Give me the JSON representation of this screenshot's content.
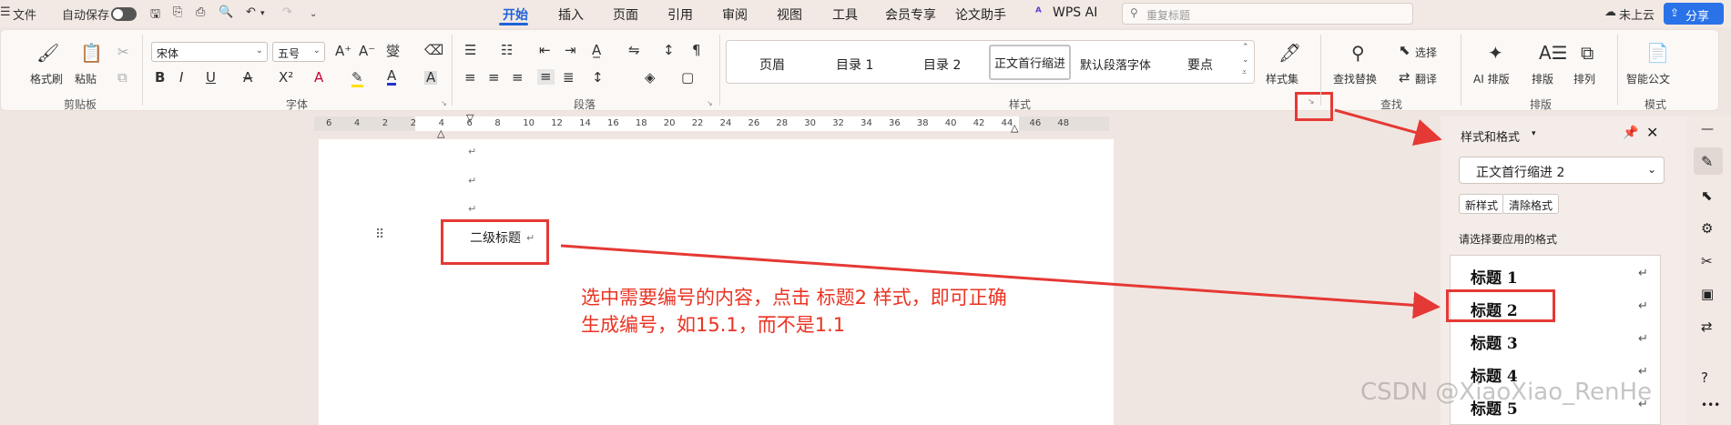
{
  "titlebar": {
    "menu_label": "文件",
    "autosave_label": "自动保存",
    "tabs": [
      "开始",
      "插入",
      "页面",
      "引用",
      "审阅",
      "视图",
      "工具",
      "会员专享",
      "论文助手",
      "WPS AI"
    ],
    "search_placeholder": "重复标题",
    "cloud_label": "未上云",
    "share_label": "分享"
  },
  "ribbon": {
    "clipboard": {
      "group": "剪贴板",
      "format_painter": "格式刷",
      "paste": "粘贴"
    },
    "font": {
      "group": "字体",
      "font_name": "宋体",
      "font_size": "五号"
    },
    "paragraph": {
      "group": "段落"
    },
    "styles": {
      "group": "样式",
      "gallery": [
        "页眉",
        "目录 1",
        "目录 2",
        "正文首行缩进",
        "默认段落字体",
        "要点"
      ],
      "style_set": "样式集"
    },
    "find": {
      "group": "查找",
      "find_replace": "查找替换",
      "select": "选择",
      "translate": "翻译"
    },
    "arrange": {
      "group": "排版",
      "ai_layout": "AI 排版",
      "layout": "排版",
      "arrange": "排列"
    },
    "template": {
      "group": "模式",
      "smart_doc": "智能公文"
    }
  },
  "ruler": {
    "numbers": [
      "6",
      "4",
      "2",
      "2",
      "4",
      "6",
      "8",
      "10",
      "12",
      "14",
      "16",
      "18",
      "20",
      "22",
      "24",
      "26",
      "28",
      "30",
      "32",
      "34",
      "36",
      "38",
      "40",
      "42",
      "44",
      "46",
      "48"
    ]
  },
  "document": {
    "heading_text": "二级标题",
    "annotation_line1": "选中需要编号的内容，点击 标题2 样式，即可正确",
    "annotation_line2": "生成编号，如15.1，而不是1.1"
  },
  "styles_panel": {
    "title": "样式和格式",
    "current_style": "正文首行缩进 2",
    "new_style": "新样式",
    "clear_format": "清除格式",
    "apply_label": "请选择要应用的格式",
    "headings": [
      "标题 1",
      "标题 2",
      "标题 3",
      "标题 4",
      "标题 5"
    ]
  },
  "watermark": "CSDN @XiaoXiao_RenHe",
  "colors": {
    "accent": "#1f62d9",
    "annotation": "#ea3323",
    "share": "#2a72e8"
  }
}
